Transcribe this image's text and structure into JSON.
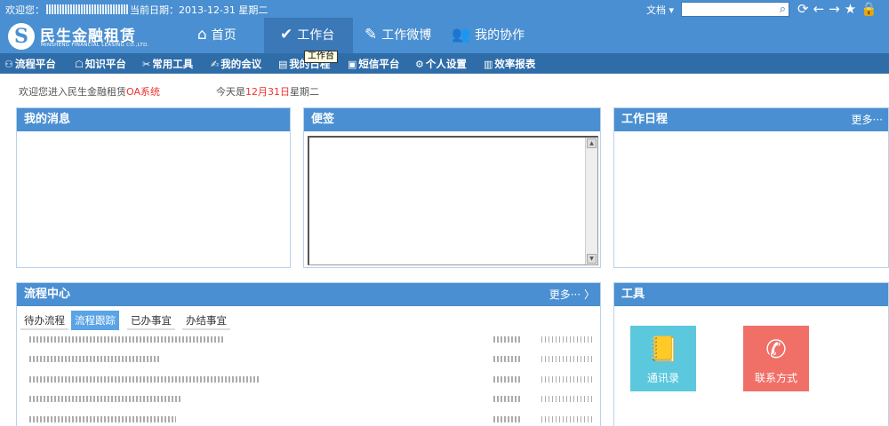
{
  "topbar": {
    "welcome_label": "欢迎您：",
    "date_label": "当前日期：2013-12-31  星期二",
    "doc_label": "文档 ▾",
    "search_placeholder": "",
    "icons": [
      "refresh-icon",
      "back-arrow-icon",
      "forward-arrow-icon",
      "star-icon",
      "lock-icon"
    ],
    "icon_glyphs": [
      "⟳",
      "←",
      "→",
      "★",
      "🔒"
    ]
  },
  "logo": {
    "name": "民生金融租赁",
    "english": "MINSHENG FINANCIAL LEASING CO.,LTD.",
    "mark": "S"
  },
  "nav": [
    {
      "label": "首页",
      "icon": "home-icon",
      "glyph": "⌂"
    },
    {
      "label": "工作台",
      "icon": "check-circle-icon",
      "glyph": "✔"
    },
    {
      "label": "工作微博",
      "icon": "user-edit-icon",
      "glyph": "✎"
    },
    {
      "label": "我的协作",
      "icon": "group-icon",
      "glyph": "👥"
    }
  ],
  "subnav": [
    {
      "label": "流程平台",
      "icon": "flow-icon",
      "glyph": "⚇"
    },
    {
      "label": "知识平台",
      "icon": "knowledge-icon",
      "glyph": "☖"
    },
    {
      "label": "常用工具",
      "icon": "tools-icon",
      "glyph": "✂"
    },
    {
      "label": "我的会议",
      "icon": "meeting-icon",
      "glyph": "✍"
    },
    {
      "label": "我的日程",
      "icon": "schedule-icon",
      "glyph": "▤"
    },
    {
      "label": "短信平台",
      "icon": "sms-icon",
      "glyph": "▣"
    },
    {
      "label": "个人设置",
      "icon": "settings-icon",
      "glyph": "⚙"
    },
    {
      "label": "效率报表",
      "icon": "report-icon",
      "glyph": "▥"
    }
  ],
  "tooltip": "工作台",
  "welcome": {
    "prefix": "欢迎您进入民生金融租赁",
    "highlight": "OA系统"
  },
  "today": {
    "prefix": "今天是",
    "date": "12月31日",
    "suffix": "星期二"
  },
  "panels": {
    "messages": {
      "title": "我的消息"
    },
    "notes": {
      "title": "便签"
    },
    "schedule": {
      "title": "工作日程",
      "more": "更多···"
    },
    "flow": {
      "title": "流程中心",
      "more": "更多··· 〉"
    },
    "tools": {
      "title": "工具"
    }
  },
  "flow_tabs": [
    "待办流程",
    "流程跟踪",
    "已办事宜",
    "办结事宜"
  ],
  "flow_active_tab": 1,
  "tools": [
    {
      "label": "通讯录",
      "icon": "address-book-icon",
      "glyph": "📒",
      "color": "#5bc8dd"
    },
    {
      "label": "联系方式",
      "icon": "phone-icon",
      "glyph": "✆",
      "color": "#f07068"
    }
  ],
  "colors": {
    "brand": "#4a8fd1",
    "subnav": "#2f6da9",
    "highlight": "#ee3333"
  }
}
